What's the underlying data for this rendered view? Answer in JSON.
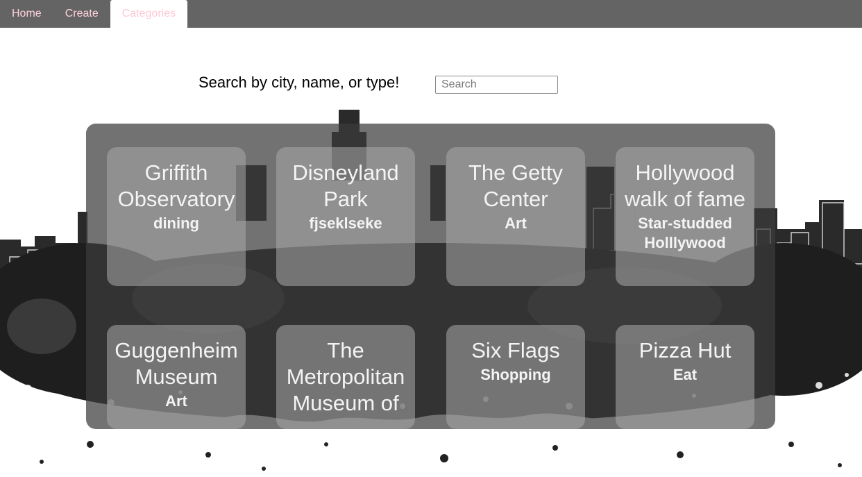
{
  "nav": {
    "tabs": [
      {
        "label": "Home"
      },
      {
        "label": "Create"
      },
      {
        "label": "Categories"
      }
    ],
    "active_index": 2,
    "colors": {
      "bar": "#646464",
      "text": "#ffd1dc"
    }
  },
  "search": {
    "label": "Search by city, name, or type!",
    "placeholder": "Search",
    "value": ""
  },
  "cards": [
    {
      "title": "Griffith Observatory",
      "type": "dining"
    },
    {
      "title": "Disneyland Park",
      "type": "fjseklseke"
    },
    {
      "title": "The Getty Center",
      "type": "Art"
    },
    {
      "title": "Hollywood walk of fame",
      "type": "Star-studded Holllywood"
    },
    {
      "title": "Guggenheim Museum",
      "type": "Art"
    },
    {
      "title": "The Metropolitan Museum of",
      "type": ""
    },
    {
      "title": "Six Flags",
      "type": "Shopping"
    },
    {
      "title": "Pizza Hut",
      "type": "Eat"
    }
  ]
}
